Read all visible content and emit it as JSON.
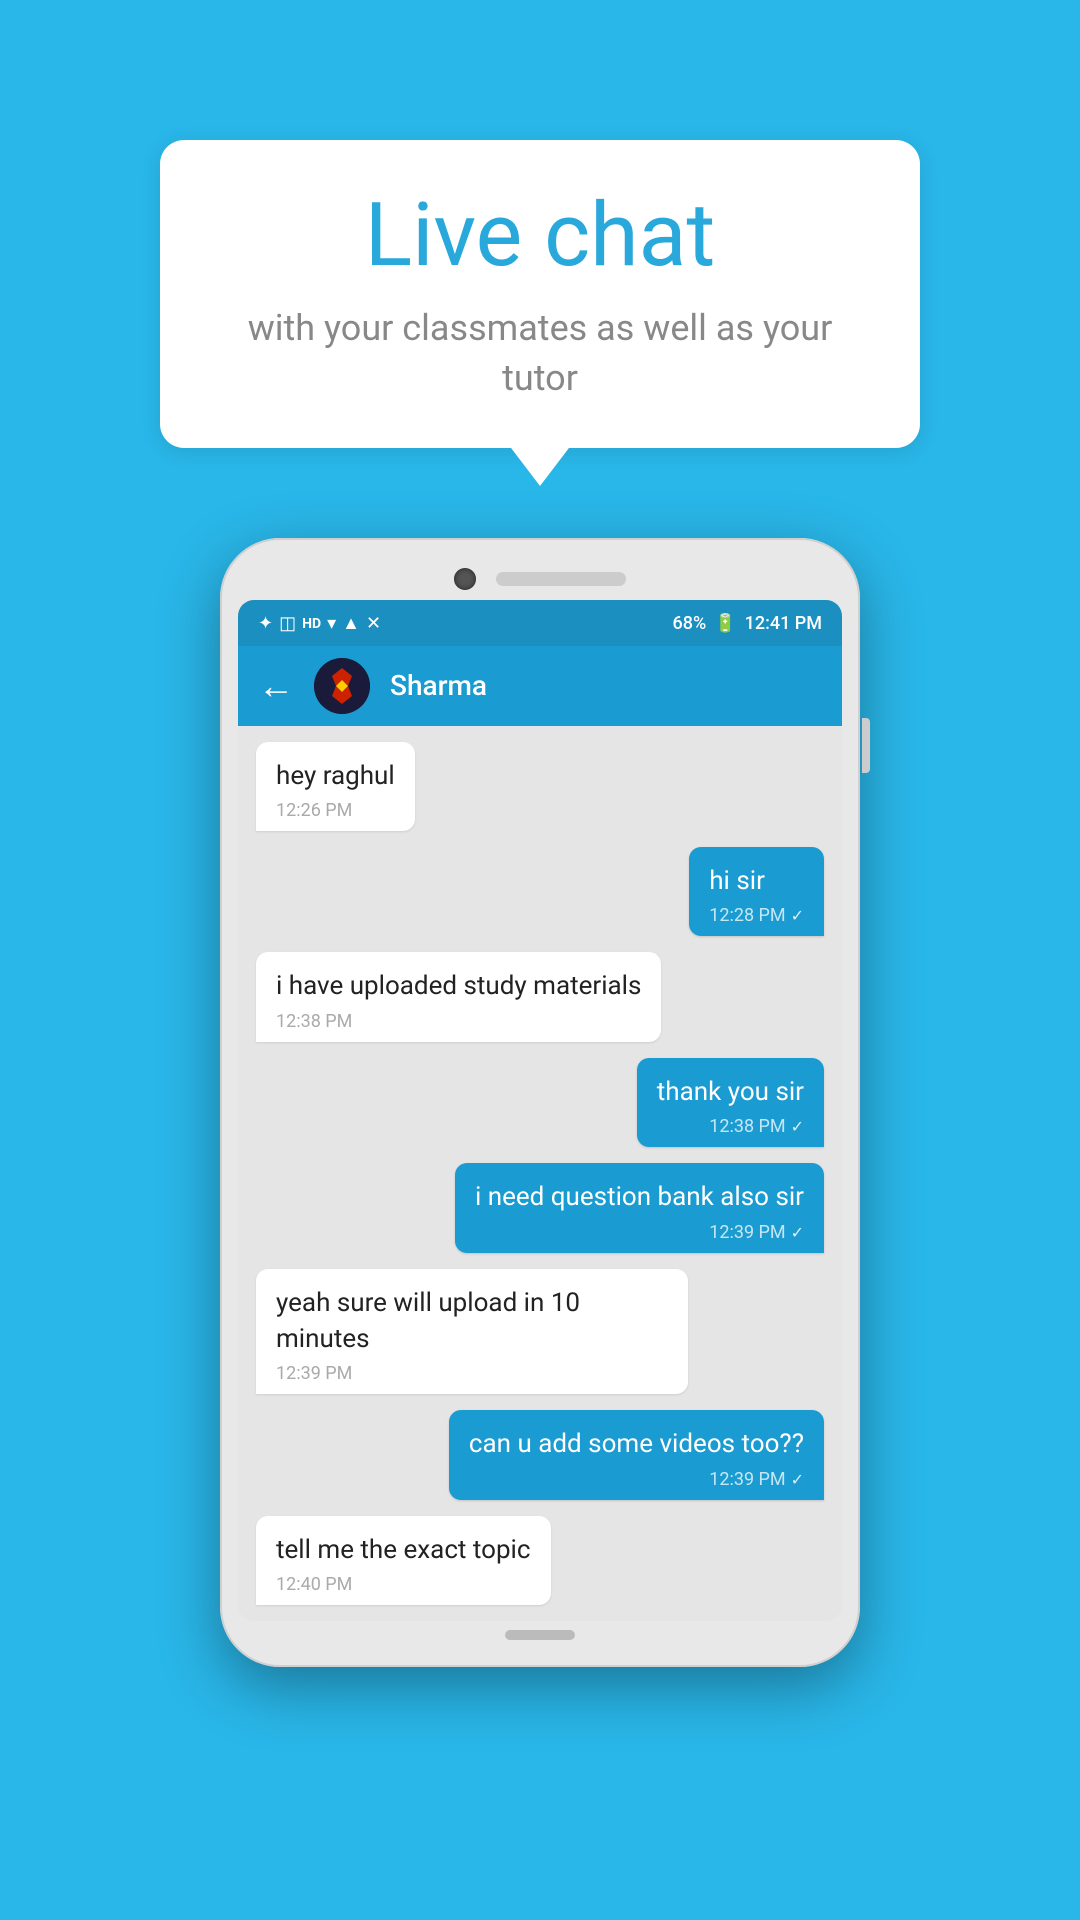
{
  "background_color": "#29b6e8",
  "tooltip": {
    "title": "Live chat",
    "subtitle": "with your classmates as well as your tutor"
  },
  "phone": {
    "status_bar": {
      "left_icons": "✦ ◫ HD ▲ ▼ ▲",
      "battery_percent": "68%",
      "time": "12:41 PM"
    },
    "app_bar": {
      "back_label": "←",
      "contact_name": "Sharma",
      "avatar_emoji": "🦸"
    },
    "messages": [
      {
        "id": 1,
        "type": "received",
        "text": "hey raghul",
        "time": "12:26 PM"
      },
      {
        "id": 2,
        "type": "sent",
        "text": "hi sir",
        "time": "12:28 PM",
        "read": true
      },
      {
        "id": 3,
        "type": "received",
        "text": "i have uploaded study materials",
        "time": "12:38 PM"
      },
      {
        "id": 4,
        "type": "sent",
        "text": "thank you sir",
        "time": "12:38 PM",
        "read": true
      },
      {
        "id": 5,
        "type": "sent",
        "text": "i need question bank also sir",
        "time": "12:39 PM",
        "read": true
      },
      {
        "id": 6,
        "type": "received",
        "text": "yeah sure will upload in 10 minutes",
        "time": "12:39 PM"
      },
      {
        "id": 7,
        "type": "sent",
        "text": "can u add some videos too??",
        "time": "12:39 PM",
        "read": true
      },
      {
        "id": 8,
        "type": "received",
        "text": "tell me the exact topic",
        "time": "12:40 PM"
      }
    ]
  }
}
